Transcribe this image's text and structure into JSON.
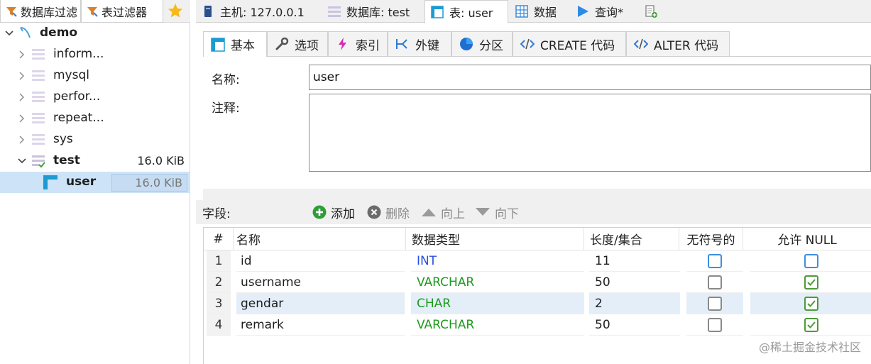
{
  "left": {
    "filter_tabs": [
      "数据库过滤",
      "表过滤器"
    ],
    "tree": [
      {
        "label": "demo",
        "type": "connection"
      },
      {
        "label": "inform...",
        "type": "database"
      },
      {
        "label": "mysql",
        "type": "database"
      },
      {
        "label": "perfor...",
        "type": "database"
      },
      {
        "label": "repeat...",
        "type": "database"
      },
      {
        "label": "sys",
        "type": "database"
      },
      {
        "label": "test",
        "type": "database",
        "size": "16.0 KiB"
      },
      {
        "label": "user",
        "type": "table",
        "size": "16.0 KiB"
      }
    ]
  },
  "top_tabs": [
    {
      "label": "主机: 127.0.0.1",
      "icon": "server-icon"
    },
    {
      "label": "数据库: test",
      "icon": "database-icon"
    },
    {
      "label": "表: user",
      "icon": "table-icon"
    },
    {
      "label": "数据",
      "icon": "grid-icon"
    },
    {
      "label": "查询*",
      "icon": "play-icon"
    }
  ],
  "sub_tabs": [
    {
      "label": "基本",
      "icon": "table-icon"
    },
    {
      "label": "选项",
      "icon": "wrench-icon"
    },
    {
      "label": "索引",
      "icon": "lightning-icon"
    },
    {
      "label": "外键",
      "icon": "foreign-key-icon"
    },
    {
      "label": "分区",
      "icon": "pie-icon"
    },
    {
      "label": "CREATE 代码",
      "icon": "code-icon"
    },
    {
      "label": "ALTER 代码",
      "icon": "code-icon"
    }
  ],
  "form": {
    "name_label": "名称:",
    "name_value": "user",
    "comment_label": "注释:",
    "comment_value": ""
  },
  "fields_bar": {
    "label": "字段:",
    "add": "添加",
    "delete": "删除",
    "up": "向上",
    "down": "向下"
  },
  "grid": {
    "headers": [
      "#",
      "名称",
      "数据类型",
      "长度/集合",
      "无符号的",
      "允许 NULL"
    ],
    "rows": [
      {
        "num": "1",
        "name": "id",
        "type": "INT",
        "length": "11",
        "unsigned": false,
        "allow_null": false
      },
      {
        "num": "2",
        "name": "username",
        "type": "VARCHAR",
        "length": "50",
        "unsigned": false,
        "allow_null": true
      },
      {
        "num": "3",
        "name": "gendar",
        "type": "CHAR",
        "length": "2",
        "unsigned": false,
        "allow_null": true
      },
      {
        "num": "4",
        "name": "remark",
        "type": "VARCHAR",
        "length": "50",
        "unsigned": false,
        "allow_null": true
      }
    ]
  },
  "colors": {
    "int_type": "#2a4fe0",
    "char_type": "#1f9a1f",
    "selection": "#cde3f7",
    "checkbox_blue": "#3d8fe0",
    "checkbox_green": "#4c9a3a"
  },
  "watermark": "@稀土掘金技术社区"
}
